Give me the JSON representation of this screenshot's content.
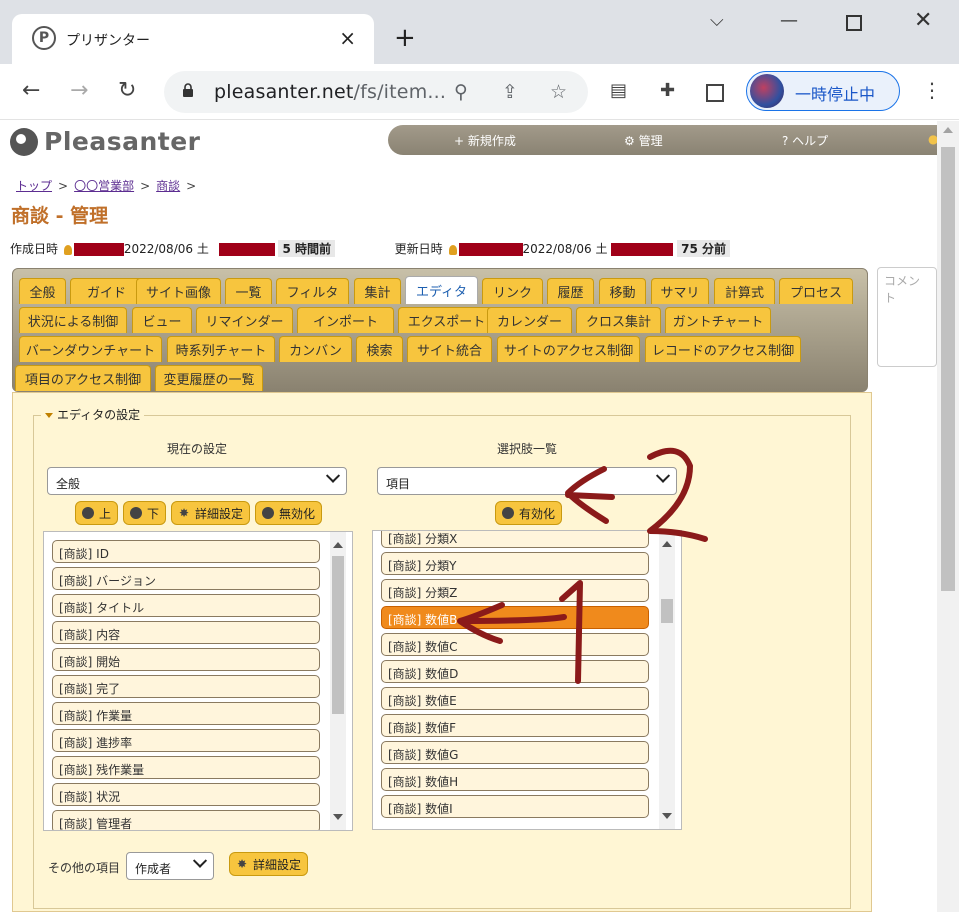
{
  "browser": {
    "tab_title": "プリザンター",
    "tab_close": "×",
    "new_tab": "+",
    "url_host": "pleasanter.net",
    "url_path": "/fs/item...",
    "profile_label": "一時停止中"
  },
  "header": {
    "logo_text": "Pleasanter",
    "nav": [
      {
        "label": "+ 新規作成"
      },
      {
        "label": "⚙ 管理"
      },
      {
        "label": "? ヘルプ"
      }
    ]
  },
  "breadcrumb": [
    {
      "label": "トップ"
    },
    {
      "label": "〇〇営業部"
    },
    {
      "label": "商談"
    }
  ],
  "breadcrumb_sep": ">",
  "page_title": "商談 - 管理",
  "meta": {
    "created_label": "作成日時",
    "created_date": "2022/08/06 土",
    "created_ago": "5 時間前",
    "updated_label": "更新日時",
    "updated_date": "2022/08/06 土",
    "updated_ago": "75 分前"
  },
  "tabs": [
    "全般",
    "ガイド",
    "サイト画像",
    "一覧",
    "フィルタ",
    "集計",
    "エディタ",
    "リンク",
    "履歴",
    "移動",
    "サマリ",
    "計算式",
    "プロセス",
    "状況による制御",
    "ビュー",
    "リマインダー",
    "インポート",
    "エクスポート",
    "カレンダー",
    "クロス集計",
    "ガントチャート",
    "バーンダウンチャート",
    "時系列チャート",
    "カンバン",
    "検索",
    "サイト統合",
    "サイトのアクセス制御",
    "レコードのアクセス制御",
    "項目のアクセス制御",
    "変更履歴の一覧"
  ],
  "active_tab": "エディタ",
  "comment_placeholder": "コメント",
  "editor": {
    "legend": "エディタの設定",
    "current_header": "現在の設定",
    "options_header": "選択肢一覧",
    "current_select": "全般",
    "options_select": "項目",
    "btn_up": "上",
    "btn_down": "下",
    "btn_detail": "詳細設定",
    "btn_disable": "無効化",
    "btn_enable": "有効化",
    "current_items": [
      "[商談] ID",
      "[商談] バージョン",
      "[商談] タイトル",
      "[商談] 内容",
      "[商談] 開始",
      "[商談] 完了",
      "[商談] 作業量",
      "[商談] 進捗率",
      "[商談] 残作業量",
      "[商談] 状況",
      "[商談] 管理者"
    ],
    "option_items": [
      "[商談] 分類X",
      "[商談] 分類Y",
      "[商談] 分類Z",
      "[商談] 数値B",
      "[商談] 数値C",
      "[商談] 数値D",
      "[商談] 数値E",
      "[商談] 数値F",
      "[商談] 数値G",
      "[商談] 数値H",
      "[商談] 数値I"
    ],
    "selected_option": "[商談] 数値B",
    "other_items_label": "その他の項目",
    "other_items_select": "作成者",
    "other_detail": "詳細設定"
  },
  "annotations": {
    "arrow1_digit": "1",
    "arrow2_digit": "2",
    "color": "#8b1a1a"
  }
}
